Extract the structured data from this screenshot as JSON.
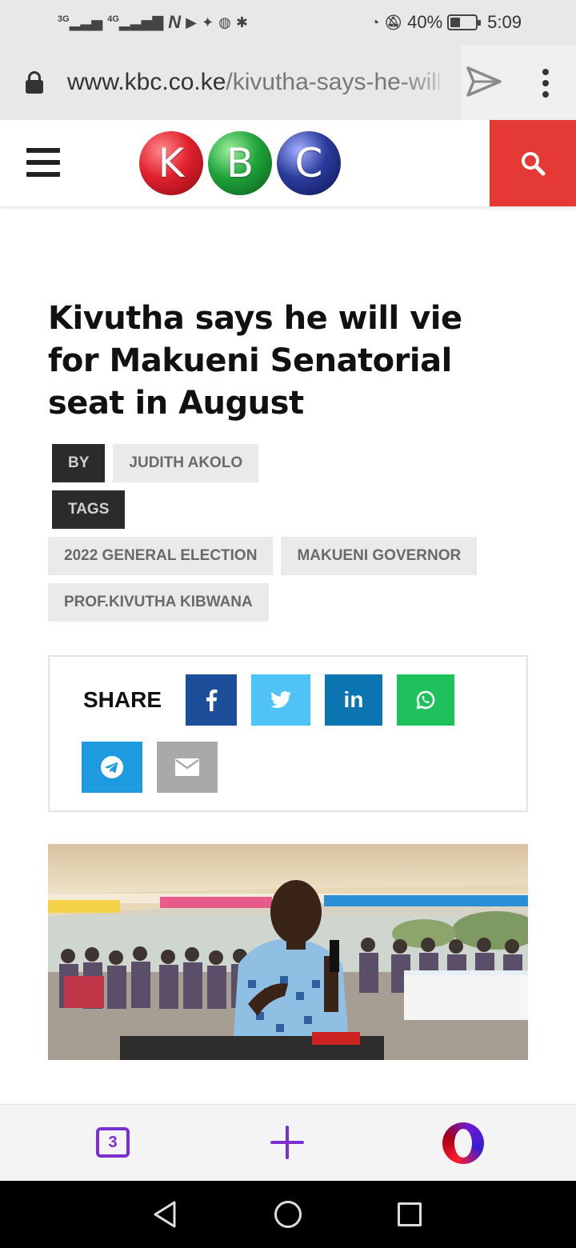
{
  "status_bar": {
    "network_1": "3G",
    "network_2": "4G",
    "battery_percent": "40%",
    "battery_level": 0.4,
    "time": "5:09"
  },
  "browser": {
    "url_host": "www.kbc.co.ke",
    "url_path": "/kivutha-says-he-will-vie-for-makueni-senatorial-seat-in-august",
    "tab_count": "3",
    "icons": [
      "lock-icon",
      "send-icon",
      "more-vert-icon",
      "plus-icon",
      "opera-icon"
    ]
  },
  "site": {
    "logo_letters": [
      "K",
      "B",
      "C"
    ],
    "colors": {
      "search_bg": "#e53935",
      "logo_red": "#e0212e",
      "logo_green": "#1ea33a",
      "logo_blue": "#2b3c9c"
    }
  },
  "article": {
    "title": "Kivutha says he will vie for Makueni Senatorial seat in August",
    "by_label": "BY",
    "author": "JUDITH AKOLO",
    "tags_label": "TAGS",
    "tags": [
      "2022 GENERAL ELECTION",
      "MAKUENI GOVERNOR",
      "PROF.KIVUTHA KIBWANA"
    ]
  },
  "share": {
    "label": "SHARE",
    "buttons": [
      {
        "name": "facebook",
        "icon": "facebook-icon",
        "color": "#1d4e9a"
      },
      {
        "name": "twitter",
        "icon": "twitter-icon",
        "color": "#4fc3f7"
      },
      {
        "name": "linkedin",
        "icon": "linkedin-icon",
        "color": "#0a75b0"
      },
      {
        "name": "whatsapp",
        "icon": "whatsapp-icon",
        "color": "#1ec15c"
      },
      {
        "name": "telegram",
        "icon": "telegram-icon",
        "color": "#1e9be0"
      },
      {
        "name": "email",
        "icon": "email-icon",
        "color": "#a9a9a9"
      }
    ]
  }
}
